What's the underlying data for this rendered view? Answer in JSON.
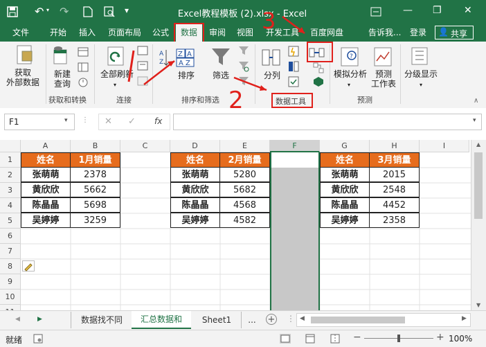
{
  "window": {
    "title": "Excel教程模板 (2).xlsx - Excel",
    "minimize": "—",
    "restore": "❐",
    "close": "✕"
  },
  "tabs": [
    "文件",
    "开始",
    "插入",
    "页面布局",
    "公式",
    "数据",
    "审阅",
    "视图",
    "开发工具",
    "百度网盘",
    "告诉我...",
    "登录",
    "共享"
  ],
  "ribbon": {
    "get_data": "获取\n外部数据",
    "new_query": "新建\n查询",
    "refresh_all": "全部刷新",
    "sort": "排序",
    "filter": "筛选",
    "split": "分列",
    "whatif": "模拟分析",
    "forecast": "预测\n工作表",
    "outline": "分级显示",
    "groups": [
      "获取和转换",
      "连接",
      "排序和筛选",
      "数据工具",
      "预测"
    ]
  },
  "annotations": {
    "n1": "1",
    "n2": "2",
    "n3": "3"
  },
  "formula_bar": {
    "name_box": "F1",
    "fx": "fx",
    "cancel": "✕",
    "confirm": "✓",
    "value": ""
  },
  "columns": [
    "A",
    "B",
    "C",
    "D",
    "E",
    "F",
    "G",
    "H",
    "I"
  ],
  "rows": [
    "1",
    "2",
    "3",
    "4",
    "5",
    "6",
    "7",
    "8",
    "9",
    "10",
    "11"
  ],
  "table1": {
    "headers": [
      "姓名",
      "1月销量"
    ],
    "rows": [
      [
        "张萌萌",
        "2378"
      ],
      [
        "黄欣欣",
        "5662"
      ],
      [
        "陈晶晶",
        "5698"
      ],
      [
        "吴婷婷",
        "3259"
      ]
    ]
  },
  "table2": {
    "headers": [
      "姓名",
      "2月销量"
    ],
    "rows": [
      [
        "张萌萌",
        "5280"
      ],
      [
        "黄欣欣",
        "5682"
      ],
      [
        "陈晶晶",
        "4568"
      ],
      [
        "吴婷婷",
        "4582"
      ]
    ]
  },
  "table3": {
    "headers": [
      "姓名",
      "3月销量"
    ],
    "rows": [
      [
        "张萌萌",
        "2015"
      ],
      [
        "黄欣欣",
        "2548"
      ],
      [
        "陈晶晶",
        "4452"
      ],
      [
        "吴婷婷",
        "2358"
      ]
    ]
  },
  "sheets": [
    "数据找不同",
    "汇总数据和",
    "Sheet1",
    "..."
  ],
  "status": {
    "ready": "就绪",
    "zoom": "100%"
  },
  "colors": {
    "excel_green": "#217346",
    "header_orange": "#e66c1d",
    "annotation_red": "#e0201b"
  }
}
